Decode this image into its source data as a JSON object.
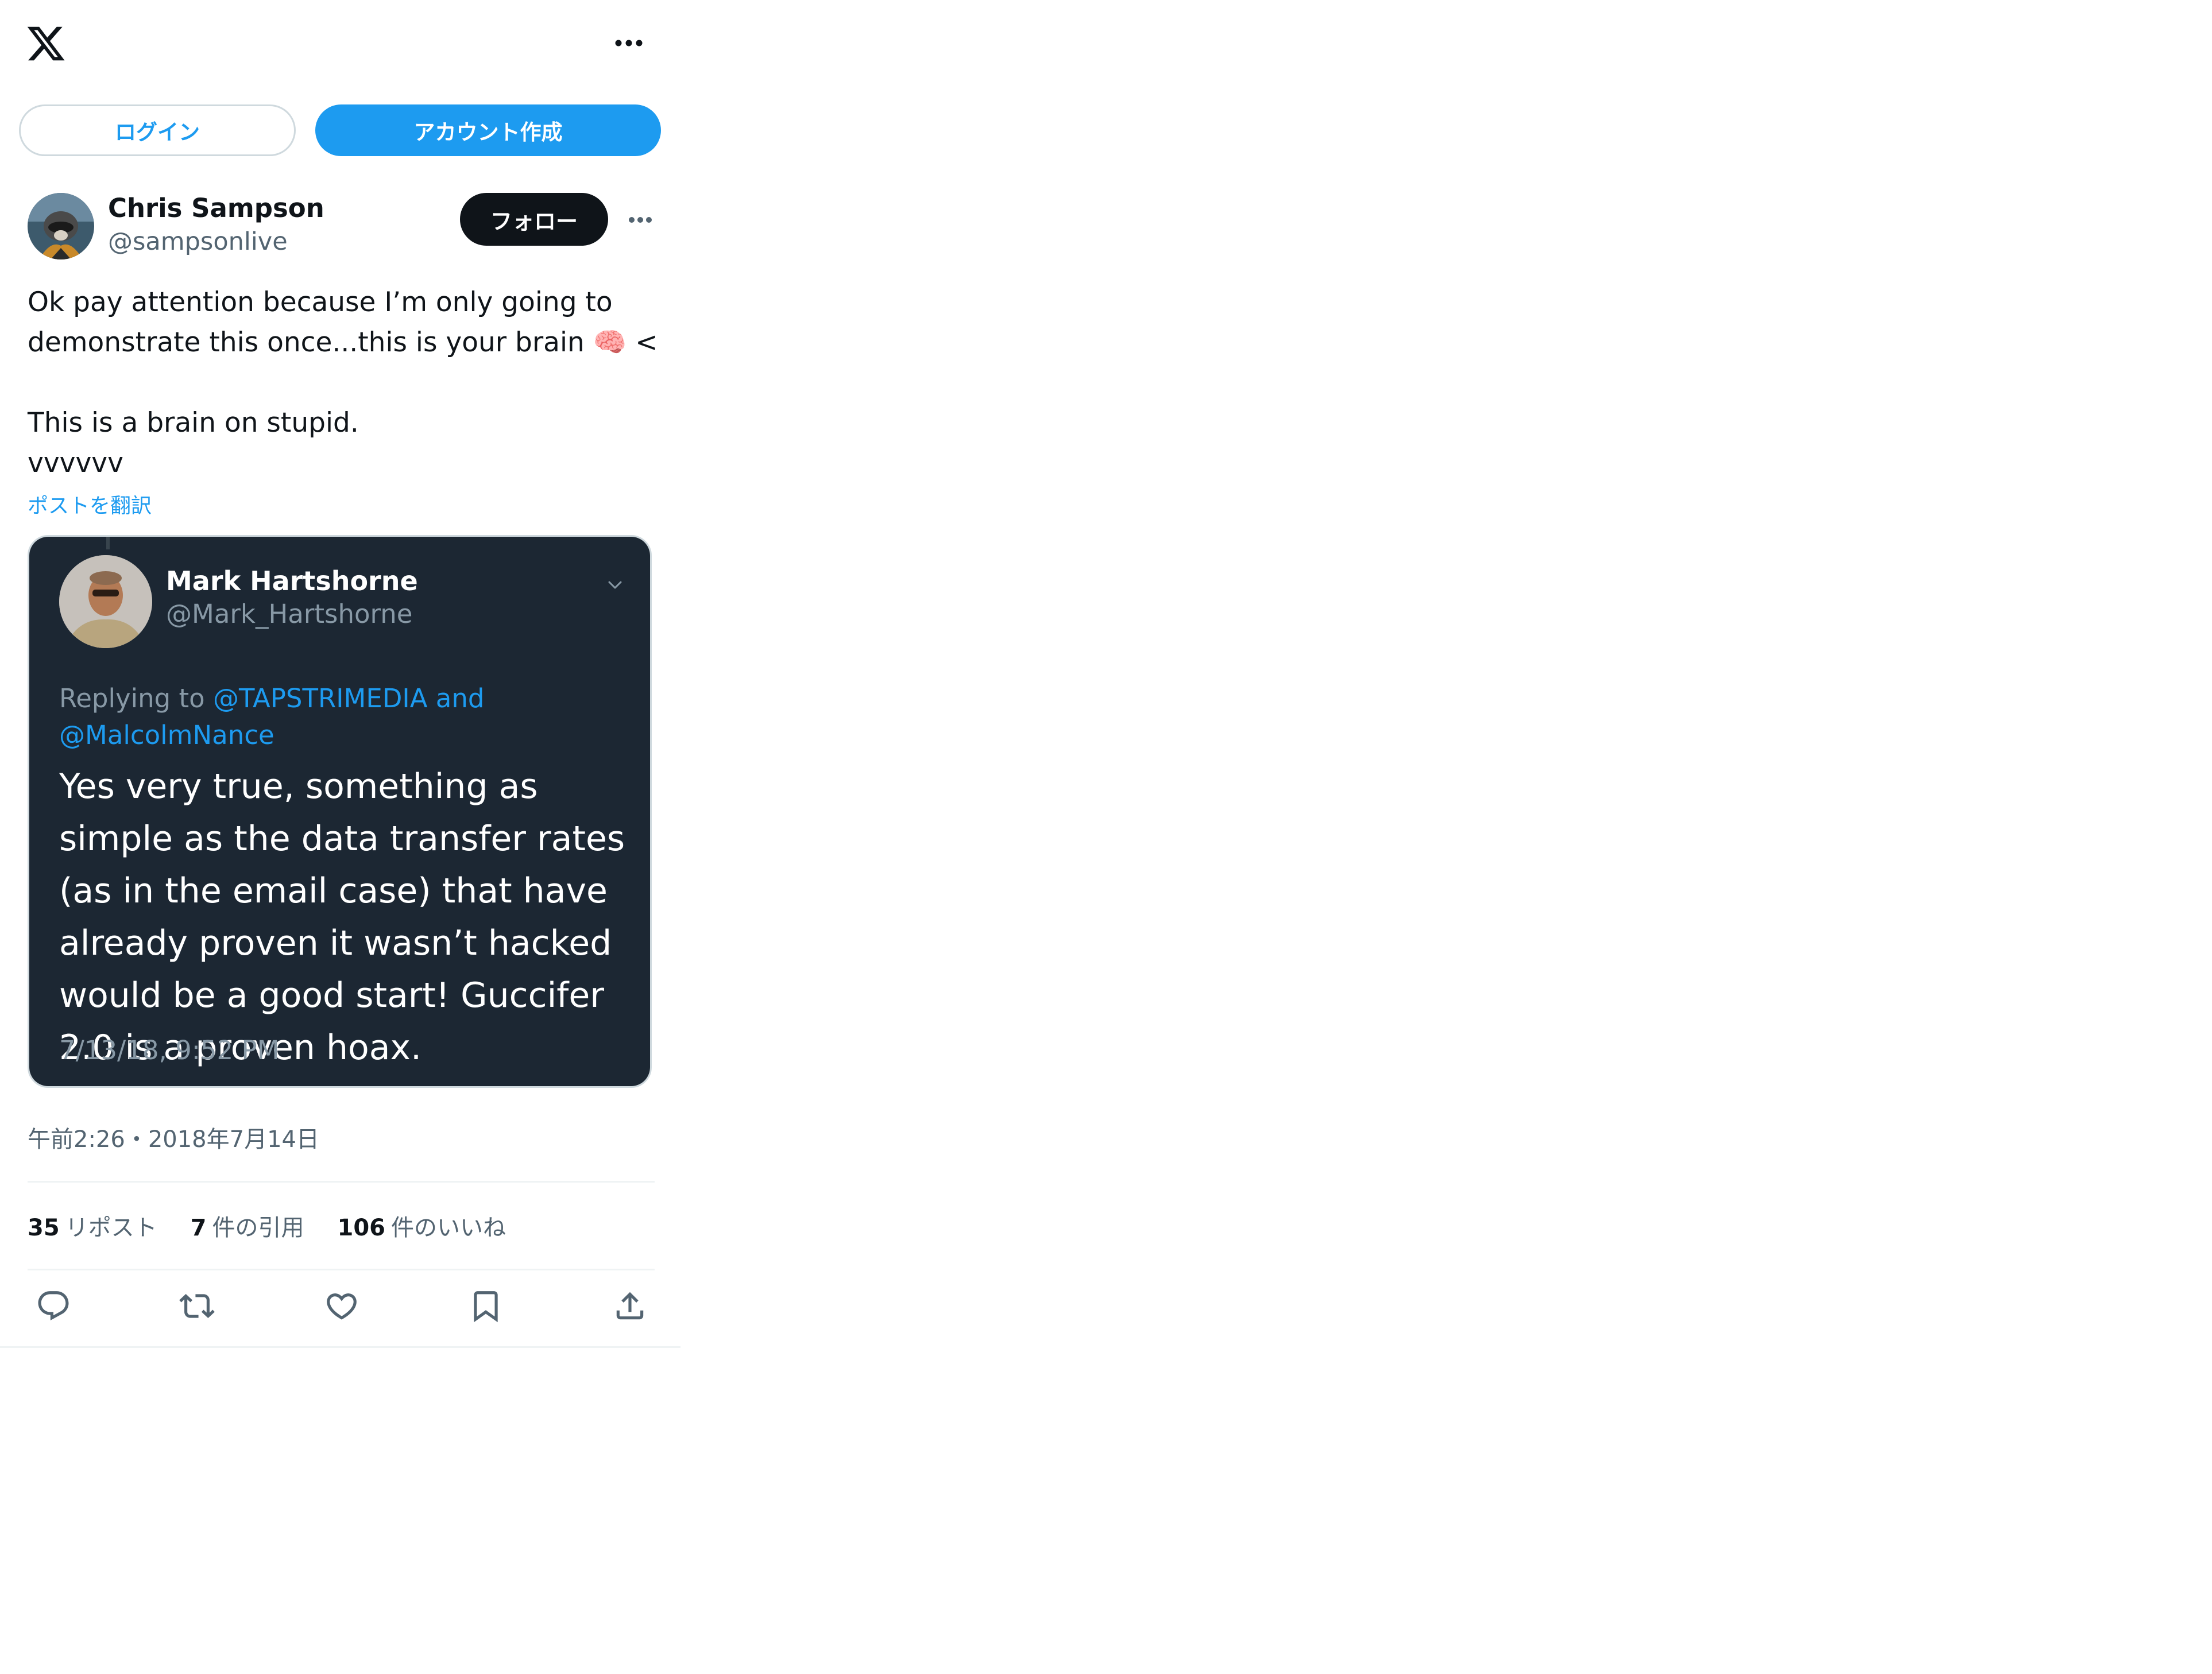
{
  "header": {
    "logo_icon": "x-logo-icon",
    "more_icon": "more-horizontal-icon"
  },
  "auth": {
    "login_label": "ログイン",
    "signup_label": "アカウント作成"
  },
  "post": {
    "author_name": "Chris Sampson",
    "author_handle": "@sampsonlive",
    "follow_label": "フォロー",
    "text": "Ok pay attention because I’m only going to demonstrate this once...this is your brain 🧠 <\n\nThis is a brain on stupid.\nvvvvvv",
    "translate_label": "ポストを翻訳",
    "timestamp": "午前2:26・2018年7月14日",
    "stats": {
      "reposts_count": "35",
      "reposts_label": "リポスト",
      "quotes_count": "7",
      "quotes_label": "件の引用",
      "likes_count": "106",
      "likes_label": "件のいいね"
    }
  },
  "embedded_image": {
    "name": "Mark Hartshorne",
    "handle": "@Mark_Hartshorne",
    "replying_prefix": "Replying to",
    "replying_links": "@TAPSTRIMEDIA and @MalcolmNance",
    "text": "Yes very true, something as simple as the data transfer rates (as in the email case) that have already proven it wasn’t hacked would be a good start! Guccifer 2.0 is a proven hoax.",
    "timestamp": "7/13/18, 9:52 PM"
  },
  "actions": [
    "reply-icon",
    "repost-icon",
    "like-icon",
    "bookmark-icon",
    "share-icon"
  ],
  "colors": {
    "accent": "#1d9bf0",
    "text": "#0f1419",
    "muted": "#536471",
    "embed_bg": "#1c2733"
  }
}
